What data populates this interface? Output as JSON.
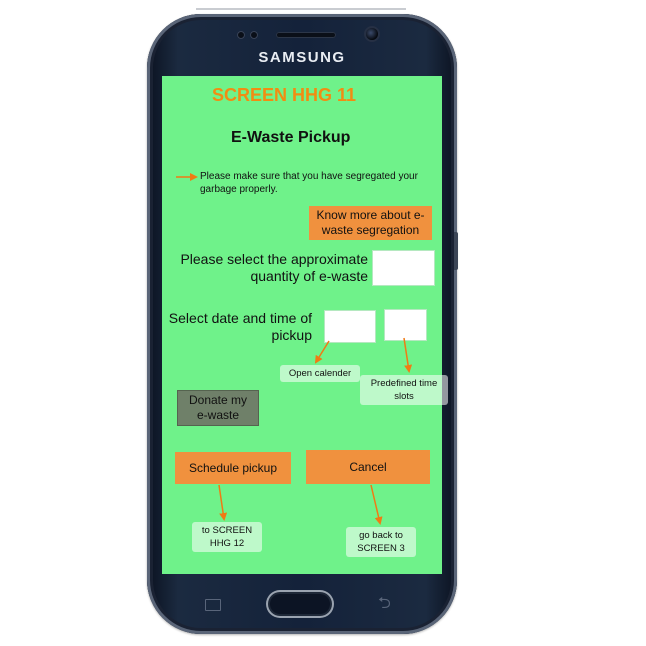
{
  "device": {
    "brand": "SAMSUNG"
  },
  "screen": {
    "title": "SCREEN HHG 11",
    "heading": "E-Waste Pickup",
    "notice": "Please make sure that you have segregated your garbage properly.",
    "know_more_button": "Know more about e-waste segregation",
    "quantity_label": "Please select the approximate quantity of e-waste",
    "date_time_label": "Select date and time of pickup",
    "donate_button": "Donate my e-waste",
    "schedule_button": "Schedule pickup",
    "cancel_button": "Cancel"
  },
  "annotations": {
    "open_calendar": "Open calender",
    "time_slots": "Predefined time slots",
    "to_screen": "to SCREEN HHG 12",
    "go_back": "go back to SCREEN 3"
  },
  "colors": {
    "screen_background": "#6ff28a",
    "title_orange": "#f28c12",
    "button_orange": "#f0913e",
    "donate_gray": "#6f8069",
    "arrow_orange": "#f07a14",
    "phone_body": "#14223a"
  },
  "icons": [
    "recent-apps-icon",
    "home-button-icon",
    "back-icon",
    "front-camera-icon",
    "speaker-grille-icon"
  ]
}
